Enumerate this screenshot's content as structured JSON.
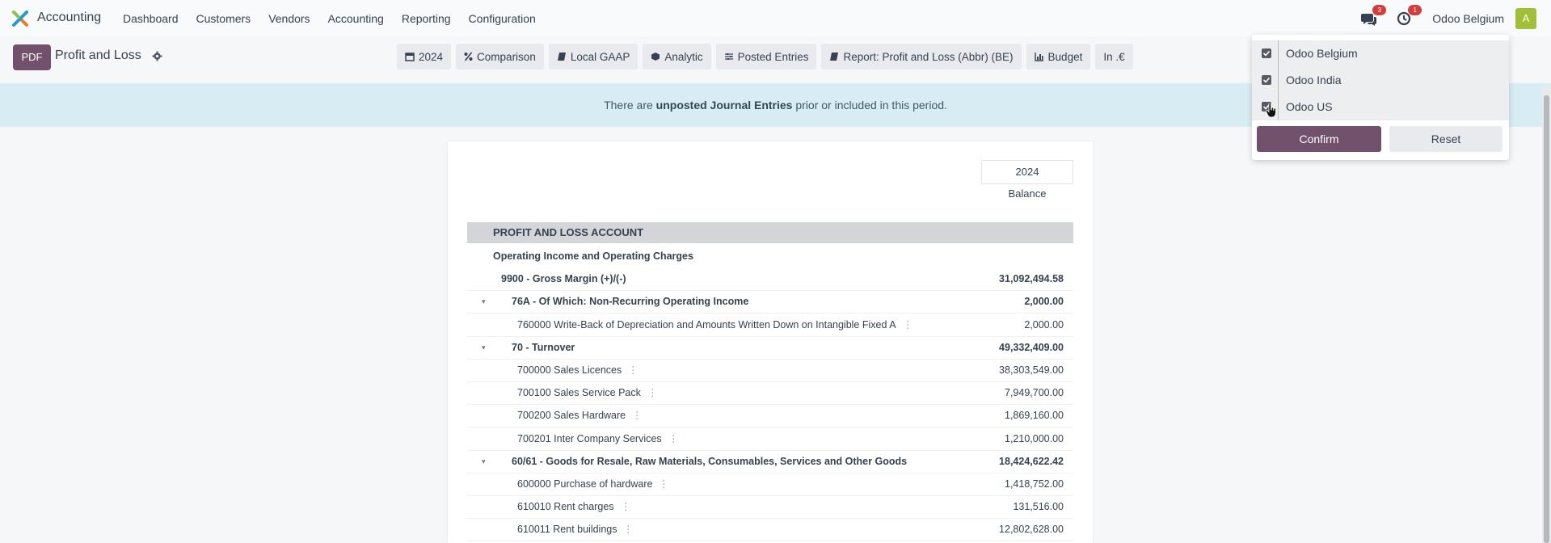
{
  "app": {
    "name": "Accounting"
  },
  "nav": {
    "items": [
      "Dashboard",
      "Customers",
      "Vendors",
      "Accounting",
      "Reporting",
      "Configuration"
    ],
    "messages_badge": "3",
    "activities_badge": "1",
    "company": "Odoo Belgium",
    "avatar_letter": "A"
  },
  "control": {
    "pdf_label": "PDF",
    "title": "Profit and Loss",
    "filters": [
      {
        "icon": "calendar-icon",
        "label": "2024"
      },
      {
        "icon": "percent-icon",
        "label": "Comparison"
      },
      {
        "icon": "book-icon",
        "label": "Local GAAP"
      },
      {
        "icon": "cube-icon",
        "label": "Analytic"
      },
      {
        "icon": "sliders-icon",
        "label": "Posted Entries"
      },
      {
        "icon": "book-icon",
        "label": "Report: Profit and Loss (Abbr) (BE)"
      },
      {
        "icon": "bar-chart-icon",
        "label": "Budget"
      },
      {
        "icon": "",
        "label": "In .€"
      }
    ]
  },
  "alert": {
    "prefix": "There are ",
    "link": "unposted Journal Entries",
    "suffix": " prior or included in this period."
  },
  "report": {
    "column_year": "2024",
    "column_label": "Balance",
    "section": "PROFIT AND LOSS ACCOUNT",
    "rows": [
      {
        "label": "Operating Income and Operating Charges",
        "value": "",
        "level": 0,
        "bold": true,
        "caret": false
      },
      {
        "label": "9900 - Gross Margin (+)/(-)",
        "value": "31,092,494.58",
        "level": 1,
        "bold": true,
        "caret": false
      },
      {
        "label": "76A - Of Which: Non-Recurring Operating Income",
        "value": "2,000.00",
        "level": 2,
        "bold": true,
        "caret": true
      },
      {
        "label": "760000 Write-Back of Depreciation and Amounts Written Down on Intangible Fixed A",
        "value": "2,000.00",
        "level": 3,
        "bold": false,
        "caret": false
      },
      {
        "label": "70 - Turnover",
        "value": "49,332,409.00",
        "level": 2,
        "bold": true,
        "caret": true
      },
      {
        "label": "700000 Sales Licences",
        "value": "38,303,549.00",
        "level": 3,
        "bold": false,
        "caret": false
      },
      {
        "label": "700100 Sales Service Pack",
        "value": "7,949,700.00",
        "level": 3,
        "bold": false,
        "caret": false
      },
      {
        "label": "700200 Sales Hardware",
        "value": "1,869,160.00",
        "level": 3,
        "bold": false,
        "caret": false
      },
      {
        "label": "700201 Inter Company Services",
        "value": "1,210,000.00",
        "level": 3,
        "bold": false,
        "caret": false
      },
      {
        "label": "60/61 - Goods for Resale, Raw Materials, Consumables, Services and Other Goods",
        "value": "18,424,622.42",
        "level": 2,
        "bold": true,
        "caret": true
      },
      {
        "label": "600000 Purchase of hardware",
        "value": "1,418,752.00",
        "level": 3,
        "bold": false,
        "caret": false
      },
      {
        "label": "610010 Rent charges",
        "value": "131,516.00",
        "level": 3,
        "bold": false,
        "caret": false
      },
      {
        "label": "610011 Rent buildings",
        "value": "12,802,628.00",
        "level": 3,
        "bold": false,
        "caret": false
      }
    ]
  },
  "company_dropdown": {
    "companies": [
      {
        "name": "Odoo Belgium",
        "checked": true
      },
      {
        "name": "Odoo India",
        "checked": true
      },
      {
        "name": "Odoo US",
        "checked": true
      }
    ],
    "confirm_label": "Confirm",
    "reset_label": "Reset"
  }
}
